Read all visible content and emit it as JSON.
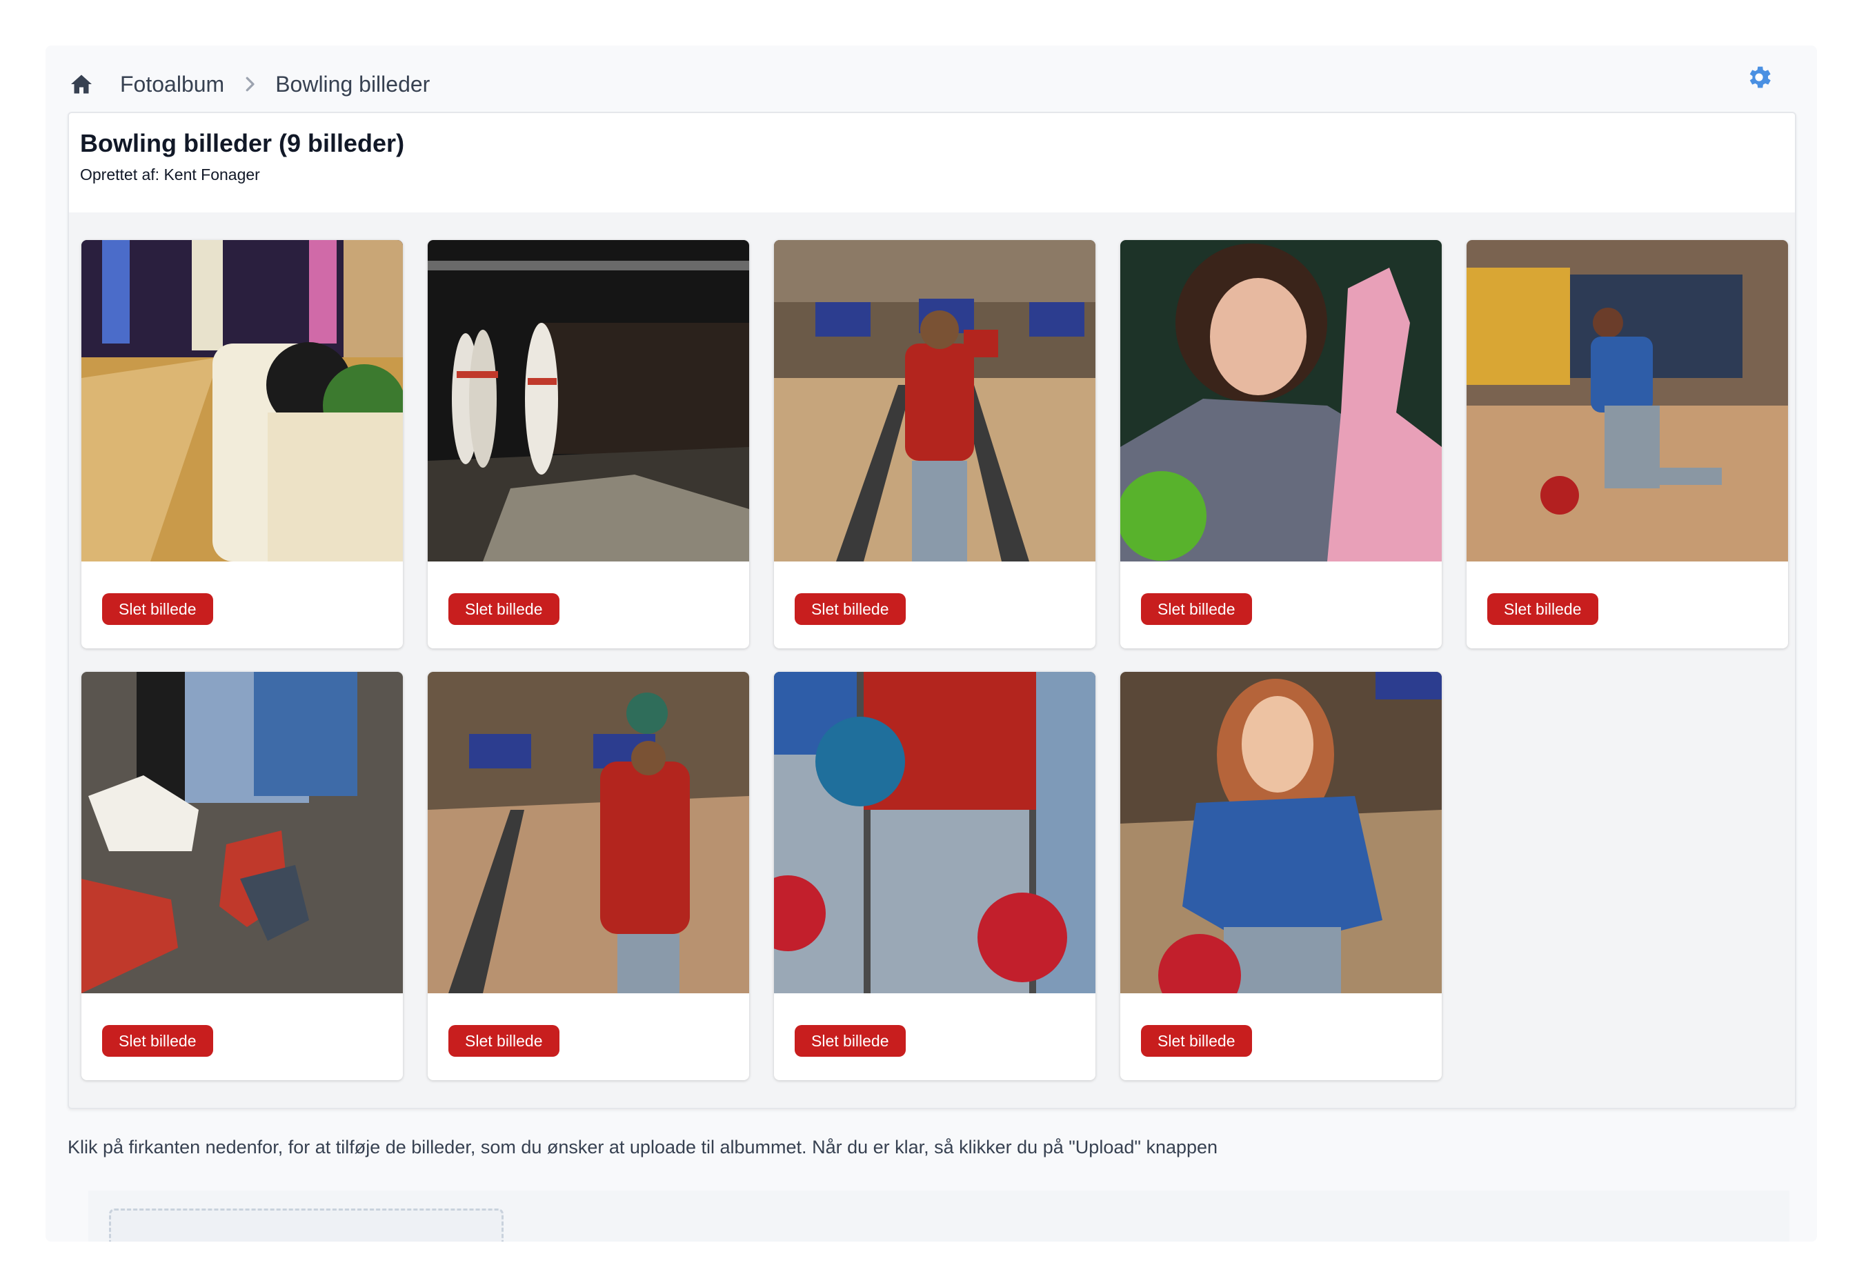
{
  "breadcrumb": {
    "home_icon": "home-icon",
    "items": [
      "Fotoalbum",
      "Bowling billeder"
    ]
  },
  "settings_icon": "gear-icon",
  "album": {
    "title": "Bowling billeder (9 billeder)",
    "created_by": "Oprettet af: Kent Fonager"
  },
  "photos": [
    {
      "delete_label": "Slet billede"
    },
    {
      "delete_label": "Slet billede"
    },
    {
      "delete_label": "Slet billede"
    },
    {
      "delete_label": "Slet billede"
    },
    {
      "delete_label": "Slet billede"
    },
    {
      "delete_label": "Slet billede"
    },
    {
      "delete_label": "Slet billede"
    },
    {
      "delete_label": "Slet billede"
    },
    {
      "delete_label": "Slet billede"
    }
  ],
  "upload": {
    "instructions": "Klik på firkanten nedenfor, for at tilføje de billeder, som du ønsker at uploade til albummet. Når du er klar, så klikker du på \"Upload\" knappen"
  },
  "colors": {
    "danger": "#c81e1e",
    "accent": "#4a90e2"
  }
}
